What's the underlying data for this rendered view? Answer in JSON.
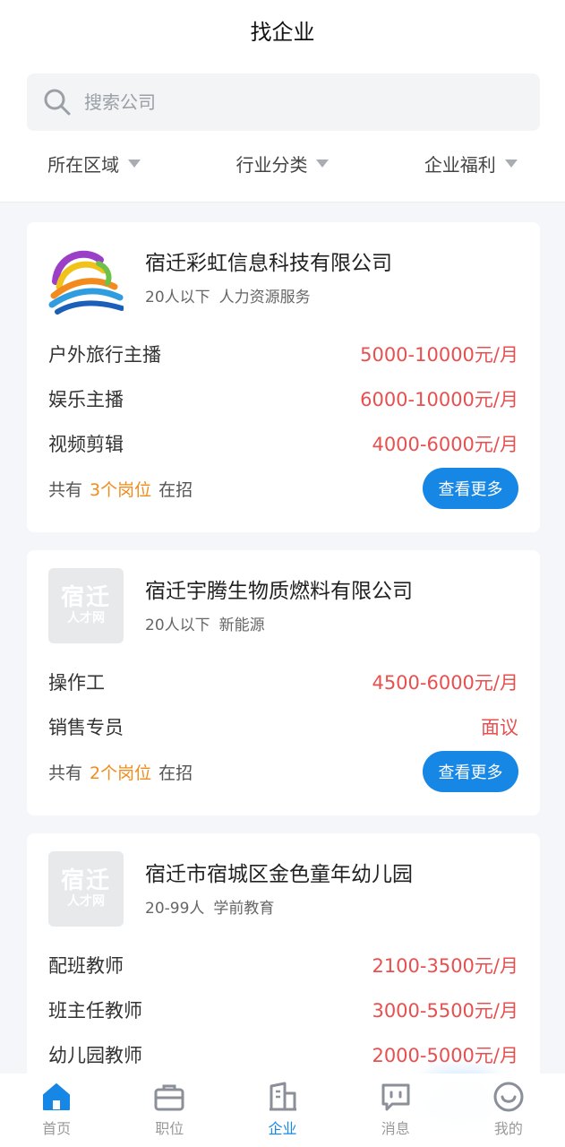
{
  "header": {
    "title": "找企业"
  },
  "search": {
    "placeholder": "搜索公司"
  },
  "filters": [
    {
      "label": "所在区域"
    },
    {
      "label": "行业分类"
    },
    {
      "label": "企业福利"
    }
  ],
  "companies": [
    {
      "name": "宿迁彩虹信息科技有限公司",
      "size": "20人以下",
      "industry": "人力资源服务",
      "logo": "rainbow-logo",
      "jobs": [
        {
          "title": "户外旅行主播",
          "salary": "5000-10000元/月"
        },
        {
          "title": "娱乐主播",
          "salary": "6000-10000元/月"
        },
        {
          "title": "视频剪辑",
          "salary": "4000-6000元/月"
        }
      ],
      "footer": {
        "prefix": "共有",
        "count": "3个岗位",
        "suffix": "在招"
      },
      "more_label": "查看更多"
    },
    {
      "name": "宿迁宇腾生物质燃料有限公司",
      "size": "20人以下",
      "industry": "新能源",
      "logo": "placeholder-logo",
      "logo_text": {
        "big": "宿迁",
        "small": "人才网"
      },
      "jobs": [
        {
          "title": "操作工",
          "salary": "4500-6000元/月"
        },
        {
          "title": "销售专员",
          "salary": "面议"
        }
      ],
      "footer": {
        "prefix": "共有",
        "count": "2个岗位",
        "suffix": "在招"
      },
      "more_label": "查看更多"
    },
    {
      "name": "宿迁市宿城区金色童年幼儿园",
      "size": "20-99人",
      "industry": "学前教育",
      "logo": "placeholder-logo",
      "logo_text": {
        "big": "宿迁",
        "small": "人才网"
      },
      "jobs": [
        {
          "title": "配班教师",
          "salary": "2100-3500元/月"
        },
        {
          "title": "班主任教师",
          "salary": "3000-5500元/月"
        },
        {
          "title": "幼儿园教师",
          "salary": "2000-5000元/月"
        }
      ]
    }
  ],
  "tabbar": [
    {
      "label": "首页",
      "icon": "home-icon"
    },
    {
      "label": "职位",
      "icon": "briefcase-icon"
    },
    {
      "label": "企业",
      "icon": "building-icon",
      "active": true
    },
    {
      "label": "消息",
      "icon": "message-icon"
    },
    {
      "label": "我的",
      "icon": "profile-icon"
    }
  ],
  "colors": {
    "accent": "#1787e6",
    "salary": "#e8504f",
    "count": "#f08c1c"
  }
}
